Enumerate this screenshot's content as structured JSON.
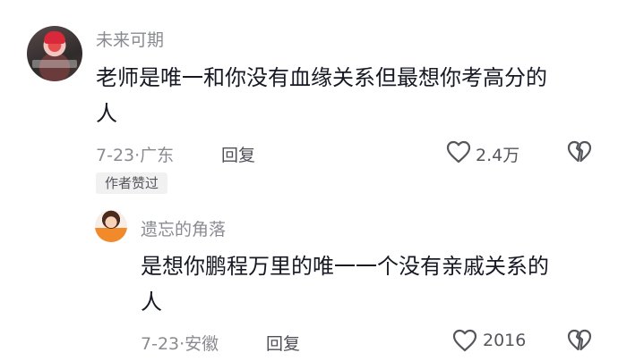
{
  "comment": {
    "username": "未来可期",
    "text_line1": "老师是唯一和你没有血缘关系但最想你考高分的",
    "text_line2": "人",
    "date": "7-23",
    "location": "广东",
    "reply_label": "回复",
    "like_count": "2.4万",
    "author_badge": "作者赞过"
  },
  "reply": {
    "username": "遗忘的角落",
    "text_line1": "是想你鹏程万里的唯一一个没有亲戚关系的",
    "text_line2": "人",
    "date": "7-23",
    "location": "安徽",
    "reply_label": "回复",
    "like_count": "2016"
  },
  "icons": {
    "like": "heart-outline-icon",
    "dislike": "broken-heart-icon"
  },
  "colors": {
    "text_primary": "#161823",
    "text_secondary": "#8a8b91",
    "badge_bg": "#f1f1f2"
  }
}
